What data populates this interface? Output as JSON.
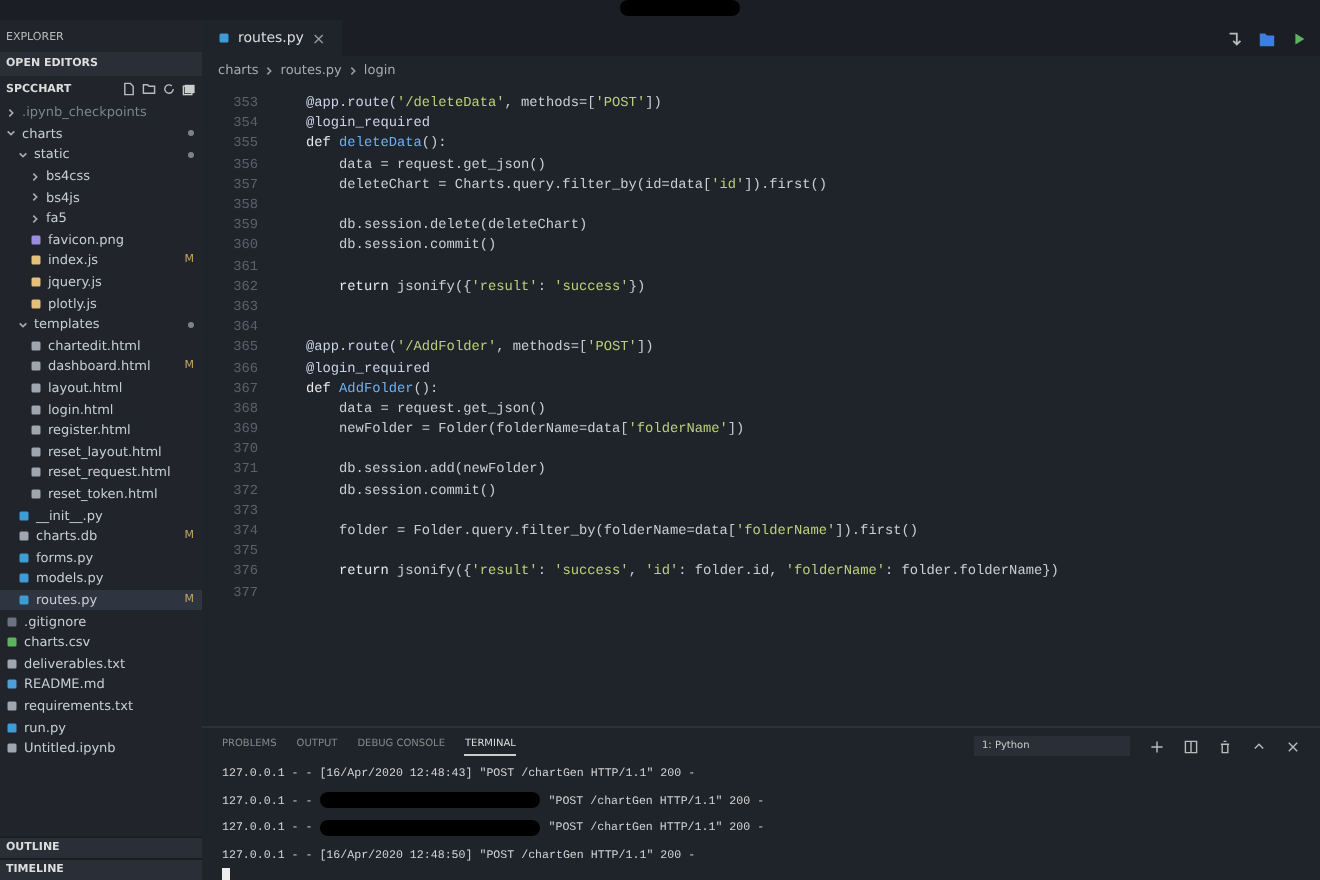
{
  "sidebar": {
    "title": "EXPLORER",
    "open_editors": "OPEN EDITORS",
    "project": "SPCCHART",
    "tree": [
      {
        "label": ".ipynb_checkpoints",
        "kind": "folder",
        "expanded": false,
        "dim": true
      },
      {
        "label": "charts",
        "kind": "folder",
        "expanded": true,
        "dot": true,
        "children": [
          {
            "label": "static",
            "kind": "folder",
            "expanded": true,
            "dot": true,
            "children": [
              {
                "label": "bs4css",
                "kind": "folder",
                "expanded": false
              },
              {
                "label": "bs4js",
                "kind": "folder",
                "expanded": false
              },
              {
                "label": "fa5",
                "kind": "folder",
                "expanded": false
              },
              {
                "label": "favicon.png",
                "kind": "image"
              },
              {
                "label": "index.js",
                "kind": "js",
                "badge": "M"
              },
              {
                "label": "jquery.js",
                "kind": "js"
              },
              {
                "label": "plotly.js",
                "kind": "js"
              }
            ]
          },
          {
            "label": "templates",
            "kind": "folder",
            "expanded": true,
            "dot": true,
            "children": [
              {
                "label": "chartedit.html",
                "kind": "html"
              },
              {
                "label": "dashboard.html",
                "kind": "html",
                "badge": "M"
              },
              {
                "label": "layout.html",
                "kind": "html"
              },
              {
                "label": "login.html",
                "kind": "html"
              },
              {
                "label": "register.html",
                "kind": "html"
              },
              {
                "label": "reset_layout.html",
                "kind": "html"
              },
              {
                "label": "reset_request.html",
                "kind": "html"
              },
              {
                "label": "reset_token.html",
                "kind": "html"
              }
            ]
          },
          {
            "label": "__init__.py",
            "kind": "py"
          },
          {
            "label": "charts.db",
            "kind": "text",
            "badge": "M"
          },
          {
            "label": "forms.py",
            "kind": "py"
          },
          {
            "label": "models.py",
            "kind": "py"
          },
          {
            "label": "routes.py",
            "kind": "py",
            "badge": "M",
            "selected": true
          }
        ]
      },
      {
        "label": ".gitignore",
        "kind": "git"
      },
      {
        "label": "charts.csv",
        "kind": "csv"
      },
      {
        "label": "deliverables.txt",
        "kind": "text"
      },
      {
        "label": "README.md",
        "kind": "md"
      },
      {
        "label": "requirements.txt",
        "kind": "text"
      },
      {
        "label": "run.py",
        "kind": "py"
      },
      {
        "label": "Untitled.ipynb",
        "kind": "text"
      }
    ],
    "bottom": [
      "OUTLINE",
      "TIMELINE"
    ]
  },
  "tab": {
    "label": "routes.py",
    "close": "×"
  },
  "breadcrumbs": [
    "charts",
    "routes.py",
    "login"
  ],
  "code": [
    {
      "n": "353",
      "tokens": [
        {
          "kind": "decorator",
          "text": "@app.route("
        },
        {
          "kind": "string",
          "text": "'/deleteData'"
        },
        {
          "kind": "plain",
          "text": ", methods=["
        },
        {
          "kind": "string",
          "text": "'POST'"
        },
        {
          "kind": "plain",
          "text": "])"
        }
      ]
    },
    {
      "n": "354",
      "tokens": [
        {
          "kind": "decorator",
          "text": "@login_required"
        }
      ]
    },
    {
      "n": "355",
      "tokens": [
        {
          "kind": "keyword",
          "text": "def "
        },
        {
          "kind": "function",
          "text": "deleteData"
        },
        {
          "kind": "plain",
          "text": "():"
        }
      ]
    },
    {
      "n": "356",
      "tokens": [
        {
          "kind": "plain",
          "text": "    data = request.get_json()"
        }
      ]
    },
    {
      "n": "357",
      "tokens": [
        {
          "kind": "plain",
          "text": "    deleteChart = Charts.query.filter_by(id=data["
        },
        {
          "kind": "string",
          "text": "'id'"
        },
        {
          "kind": "plain",
          "text": "]).first()"
        }
      ]
    },
    {
      "n": "358"
    },
    {
      "n": "359",
      "tokens": [
        {
          "kind": "plain",
          "text": "    db.session.delete(deleteChart)"
        }
      ]
    },
    {
      "n": "360",
      "tokens": [
        {
          "kind": "plain",
          "text": "    db.session.commit()"
        }
      ]
    },
    {
      "n": "361"
    },
    {
      "n": "362",
      "tokens": [
        {
          "kind": "keyword",
          "text": "    return "
        },
        {
          "kind": "plain",
          "text": "jsonify({"
        },
        {
          "kind": "string",
          "text": "'result'"
        },
        {
          "kind": "plain",
          "text": ": "
        },
        {
          "kind": "string",
          "text": "'success'"
        },
        {
          "kind": "plain",
          "text": "})"
        }
      ]
    },
    {
      "n": "363"
    },
    {
      "n": "364"
    },
    {
      "n": "365",
      "tokens": [
        {
          "kind": "decorator",
          "text": "@app.route("
        },
        {
          "kind": "string",
          "text": "'/AddFolder'"
        },
        {
          "kind": "plain",
          "text": ", methods=["
        },
        {
          "kind": "string",
          "text": "'POST'"
        },
        {
          "kind": "plain",
          "text": "])"
        }
      ]
    },
    {
      "n": "366",
      "tokens": [
        {
          "kind": "decorator",
          "text": "@login_required"
        }
      ]
    },
    {
      "n": "367",
      "tokens": [
        {
          "kind": "keyword",
          "text": "def "
        },
        {
          "kind": "function",
          "text": "AddFolder"
        },
        {
          "kind": "plain",
          "text": "():"
        }
      ]
    },
    {
      "n": "368",
      "tokens": [
        {
          "kind": "plain",
          "text": "    data = request.get_json()"
        }
      ]
    },
    {
      "n": "369",
      "tokens": [
        {
          "kind": "plain",
          "text": "    newFolder = Folder(folderName=data["
        },
        {
          "kind": "string",
          "text": "'folderName'"
        },
        {
          "kind": "plain",
          "text": "])"
        }
      ]
    },
    {
      "n": "370"
    },
    {
      "n": "371",
      "tokens": [
        {
          "kind": "plain",
          "text": "    db.session.add(newFolder)"
        }
      ]
    },
    {
      "n": "372",
      "tokens": [
        {
          "kind": "plain",
          "text": "    db.session.commit()"
        }
      ]
    },
    {
      "n": "373"
    },
    {
      "n": "374",
      "tokens": [
        {
          "kind": "plain",
          "text": "    folder = Folder.query.filter_by(folderName=data["
        },
        {
          "kind": "string",
          "text": "'folderName'"
        },
        {
          "kind": "plain",
          "text": "]).first()"
        }
      ]
    },
    {
      "n": "375"
    },
    {
      "n": "376",
      "tokens": [
        {
          "kind": "keyword",
          "text": "    return "
        },
        {
          "kind": "plain",
          "text": "jsonify({"
        },
        {
          "kind": "string",
          "text": "'result'"
        },
        {
          "kind": "plain",
          "text": ": "
        },
        {
          "kind": "string",
          "text": "'success'"
        },
        {
          "kind": "plain",
          "text": ", "
        },
        {
          "kind": "string",
          "text": "'id'"
        },
        {
          "kind": "plain",
          "text": ": folder.id, "
        },
        {
          "kind": "string",
          "text": "'folderName'"
        },
        {
          "kind": "plain",
          "text": ": folder.folderName})"
        }
      ]
    },
    {
      "n": "377"
    }
  ],
  "panel": {
    "tabs": [
      {
        "label": "PROBLEMS",
        "selected": false
      },
      {
        "label": "OUTPUT",
        "selected": false
      },
      {
        "label": "DEBUG CONSOLE",
        "selected": false
      },
      {
        "label": "TERMINAL",
        "selected": true
      }
    ],
    "shell": "1: Python",
    "lines": [
      {
        "before": "127.0.0.1 - - [16/Apr/2020 12:48:43] \"POST /chartGen HTTP/1.1\" 200 -",
        "redacted": false
      },
      {
        "before": "127.0.0.1 - -",
        "after": "\"POST /chartGen HTTP/1.1\" 200 -",
        "redacted": true
      },
      {
        "before": "127.0.0.1 - -",
        "after": "\"POST /chartGen HTTP/1.1\" 200 -",
        "redacted": true
      },
      {
        "before": "127.0.0.1 - - [16/Apr/2020 12:48:50] \"POST /chartGen HTTP/1.1\" 200 -",
        "redacted": false
      }
    ]
  }
}
